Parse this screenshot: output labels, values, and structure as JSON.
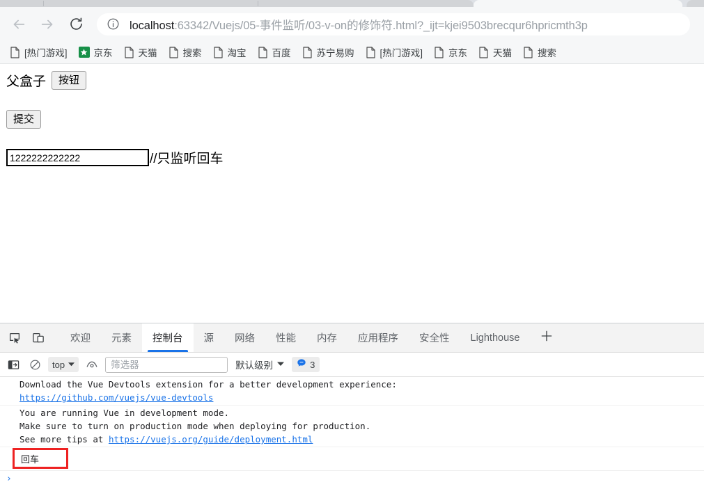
{
  "browser": {
    "nav": {
      "back_icon": "arrow-left-icon",
      "forward_icon": "arrow-right-icon",
      "reload_icon": "reload-icon"
    },
    "omnibox": {
      "info_icon": "info-circle-icon",
      "host": "localhost",
      "path": ":63342/Vuejs/05-事件监听/03-v-on的修饰符.html?_ijt=kjei9503brecqur6hpricmth3p",
      "full_url": "localhost:63342/Vuejs/05-事件监听/03-v-on的修饰符.html?_ijt=kjei9503brecqur6hpricmth3p"
    },
    "bookmarks": [
      {
        "label": "[热门游戏]",
        "icon": "page-doc-icon"
      },
      {
        "label": "京东",
        "icon": "jd-green-icon"
      },
      {
        "label": "天猫",
        "icon": "page-doc-icon"
      },
      {
        "label": "搜索",
        "icon": "page-doc-icon"
      },
      {
        "label": "淘宝",
        "icon": "page-doc-icon"
      },
      {
        "label": "百度",
        "icon": "page-doc-icon"
      },
      {
        "label": "苏宁易购",
        "icon": "page-doc-icon"
      },
      {
        "label": "[热门游戏]",
        "icon": "page-doc-icon"
      },
      {
        "label": "京东",
        "icon": "page-doc-icon"
      },
      {
        "label": "天猫",
        "icon": "page-doc-icon"
      },
      {
        "label": "搜索",
        "icon": "page-doc-icon"
      }
    ]
  },
  "page": {
    "parent_box_label": "父盒子",
    "button_label": "按钮",
    "submit_label": "提交",
    "input_value": "1222222222222",
    "input_comment": "//只监听回车"
  },
  "devtools": {
    "left_icons": [
      {
        "name": "inspect-element-icon"
      },
      {
        "name": "device-toolbar-icon"
      }
    ],
    "tabs": [
      {
        "label": "欢迎",
        "selected": false
      },
      {
        "label": "元素",
        "selected": false
      },
      {
        "label": "控制台",
        "selected": true
      },
      {
        "label": "源",
        "selected": false
      },
      {
        "label": "网络",
        "selected": false
      },
      {
        "label": "性能",
        "selected": false
      },
      {
        "label": "内存",
        "selected": false
      },
      {
        "label": "应用程序",
        "selected": false
      },
      {
        "label": "安全性",
        "selected": false
      },
      {
        "label": "Lighthouse",
        "selected": false
      }
    ],
    "add_tab_icon": "plus-icon",
    "console_toolbar": {
      "sidebar_icon": "console-sidebar-icon",
      "clear_icon": "clear-console-icon",
      "context_value": "top",
      "context_chevron": "chevron-down-icon",
      "eye_icon": "live-expression-eye-icon",
      "filter_placeholder": "筛选器",
      "filter_value": "",
      "level_value": "默认级别",
      "level_chevron": "chevron-down-icon",
      "message_badge_icon": "speech-bubble-icon",
      "message_count": "3",
      "accent_blue": "#1a73e8"
    },
    "console_messages": [
      {
        "id": "vue-devtools-msg",
        "lines": [
          {
            "text": "Download the Vue Devtools extension for a better development experience:",
            "link": false
          },
          {
            "text": "https://github.com/vuejs/vue-devtools",
            "link": true
          }
        ]
      },
      {
        "id": "vue-dev-mode-msg",
        "lines": [
          {
            "text": "You are running Vue in development mode.",
            "link": false
          },
          {
            "text": "Make sure to turn on production mode when deploying for production.",
            "link": false
          },
          {
            "text": "See more tips at ",
            "link": false,
            "suffix_link": "https://vuejs.org/guide/deployment.html"
          }
        ]
      }
    ],
    "logged_enter": {
      "text": "回车",
      "highlight_color": "#ee2222"
    },
    "prompt_chevron": "›"
  }
}
